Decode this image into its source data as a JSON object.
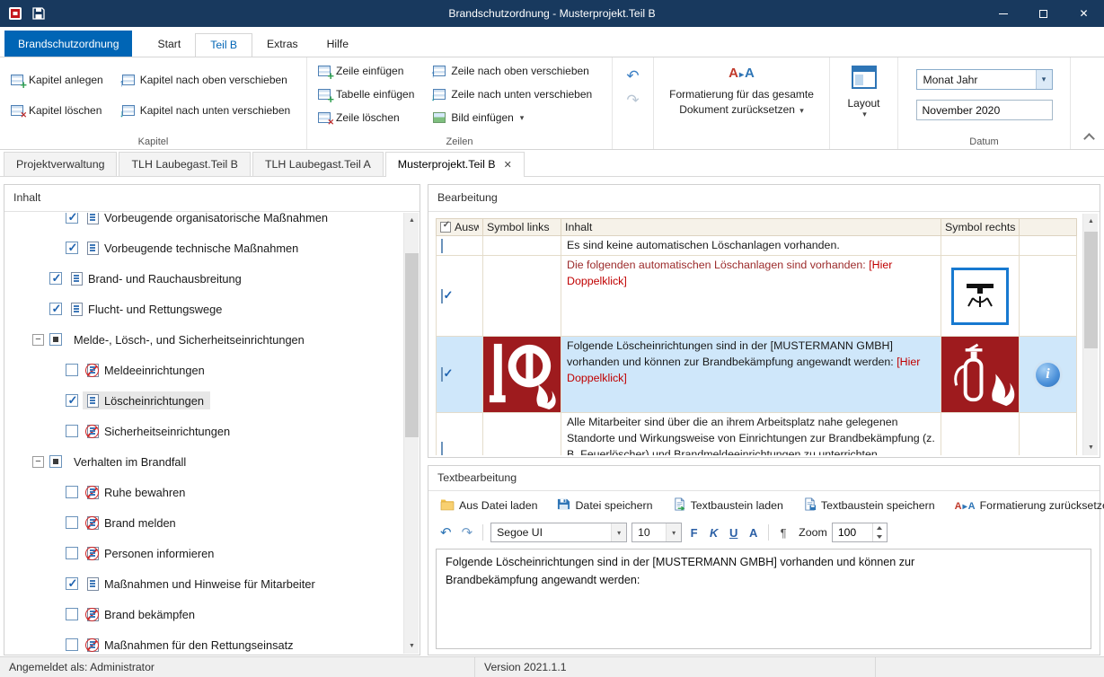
{
  "glyphs": {
    "dropdown": "▾",
    "close": "✕",
    "tab_close": "✕",
    "undo": "↶",
    "redo": "↷",
    "expander_open": "−"
  },
  "titlebar": {
    "title": "Brandschutzordnung - Musterprojekt.Teil B"
  },
  "menubar": {
    "app_button": "Brandschutzordnung",
    "tabs": [
      {
        "label": "Start",
        "active": false
      },
      {
        "label": "Teil B",
        "active": true
      },
      {
        "label": "Extras",
        "active": false
      },
      {
        "label": "Hilfe",
        "active": false
      }
    ]
  },
  "ribbon": {
    "kapitel": {
      "group_label": "Kapitel",
      "anlegen": "Kapitel anlegen",
      "loeschen": "Kapitel löschen",
      "nach_oben": "Kapitel nach oben verschieben",
      "nach_unten": "Kapitel nach unten verschieben"
    },
    "zeilen": {
      "group_label": "Zeilen",
      "zeile_einfuegen": "Zeile einfügen",
      "tabelle_einfuegen": "Tabelle einfügen",
      "zeile_loeschen": "Zeile löschen",
      "zeile_nach_oben": "Zeile nach oben verschieben",
      "zeile_nach_unten": "Zeile nach unten verschieben",
      "bild_einfuegen": "Bild einfügen"
    },
    "formatierung_zuruecksetzen": "Formatierung für das gesamte Dokument zurücksetzen",
    "layout_label": "Layout",
    "datum": {
      "group_label": "Datum",
      "format": "Monat Jahr",
      "wert": "November 2020"
    }
  },
  "document_tabs": [
    {
      "label": "Projektverwaltung",
      "active": false
    },
    {
      "label": "TLH Laubegast.Teil B",
      "active": false
    },
    {
      "label": "TLH Laubegast.Teil A",
      "active": false
    },
    {
      "label": "Musterprojekt.Teil B",
      "active": true
    }
  ],
  "inhalt": {
    "title": "Inhalt",
    "items": [
      {
        "label": "Vorbeugende organisatorische Maßnahmen",
        "level": 1,
        "checked": true,
        "print_icon": "print"
      },
      {
        "label": "Vorbeugende technische Maßnahmen",
        "level": 1,
        "checked": true,
        "print_icon": "print"
      },
      {
        "label": "Brand- und Rauchausbreitung",
        "level": 0,
        "checked": true,
        "print_icon": "print"
      },
      {
        "label": "Flucht- und Rettungswege",
        "level": 0,
        "checked": true,
        "print_icon": "print"
      },
      {
        "label": "Melde-, Lösch-, und Sicherheitseinrichtungen",
        "level": 0,
        "checked": "partial",
        "expanded": true
      },
      {
        "label": "Meldeeinrichtungen",
        "level": 1,
        "checked": false,
        "print_icon": "no-print"
      },
      {
        "label": "Löscheinrichtungen",
        "level": 1,
        "checked": true,
        "print_icon": "print",
        "selected": true
      },
      {
        "label": "Sicherheitseinrichtungen",
        "level": 1,
        "checked": false,
        "print_icon": "no-print"
      },
      {
        "label": "Verhalten im Brandfall",
        "level": 0,
        "checked": "partial",
        "expanded": true
      },
      {
        "label": "Ruhe bewahren",
        "level": 1,
        "checked": false,
        "print_icon": "no-print"
      },
      {
        "label": "Brand melden",
        "level": 1,
        "checked": false,
        "print_icon": "no-print"
      },
      {
        "label": "Personen informieren",
        "level": 1,
        "checked": false,
        "print_icon": "no-print"
      },
      {
        "label": "Maßnahmen und Hinweise für Mitarbeiter",
        "level": 1,
        "checked": true,
        "print_icon": "print"
      },
      {
        "label": "Brand bekämpfen",
        "level": 1,
        "checked": false,
        "print_icon": "no-print"
      },
      {
        "label": "Maßnahmen für den Rettungseinsatz",
        "level": 1,
        "checked": false,
        "print_icon": "no-print"
      }
    ]
  },
  "bearbeitung": {
    "title": "Bearbeitung",
    "columns": {
      "auswahl": "Auswahl",
      "symbol_links": "Symbol links",
      "inhalt": "Inhalt",
      "symbol_rechts": "Symbol rechts"
    },
    "rows": [
      {
        "checked": false,
        "text": "Es sind keine automatischen Löschanlagen vorhanden."
      },
      {
        "checked": true,
        "text": "Die folgenden automatischen Löschanlagen sind vorhanden:",
        "suffix": "[Hier Doppelklick]",
        "symbol_rechts_icon": "sprinkler-symbol"
      },
      {
        "checked": true,
        "selected": true,
        "symbol_links_icon": "fire-hose-reel-symbol",
        "symbol_rechts_icon": "fire-extinguisher-symbol",
        "info_icon": true,
        "text": "Folgende Löscheinrichtungen sind in der [MUSTERMANN GMBH] vorhanden und können zur Brandbekämpfung angewandt werden:",
        "suffix": "[Hier Doppelklick]"
      },
      {
        "checked": false,
        "text": "Alle Mitarbeiter sind über die an ihrem Arbeitsplatz nahe gelegenen Standorte und Wirkungsweise von Einrichtungen zur Brandbekämpfung (z. B. Feuerlöscher) und Brandmeldeeinrichtungen zu unterrichten."
      }
    ]
  },
  "textbearbeitung": {
    "title": "Textbearbeitung",
    "file_toolbar": {
      "aus_datei_laden": "Aus Datei laden",
      "datei_speichern": "Datei speichern",
      "textbaustein_laden": "Textbaustein laden",
      "textbaustein_speichern": "Textbaustein speichern",
      "formatierung_zuruecksetzen": "Formatierung zurücksetzen"
    },
    "format_toolbar": {
      "font": "Segoe UI",
      "size": "10",
      "bold": "F",
      "italic": "K",
      "underline": "U",
      "font_color": "A",
      "pilcrow": "¶",
      "zoom_label": "Zoom",
      "zoom_value": "100"
    },
    "editor_lines": [
      "Folgende Löscheinrichtungen sind in der [MUSTERMANN GMBH] vorhanden und können zur",
      "Brandbekämpfung angewandt werden:"
    ]
  },
  "statusbar": {
    "angemeldet": "Angemeldet als: Administrator",
    "version": "Version 2021.1.1"
  },
  "colors": {
    "titlebar": "#18395e",
    "accent_blue": "#0065b5",
    "safety_red": "#9e1b1e",
    "selection_blue": "#cfe7fa"
  }
}
